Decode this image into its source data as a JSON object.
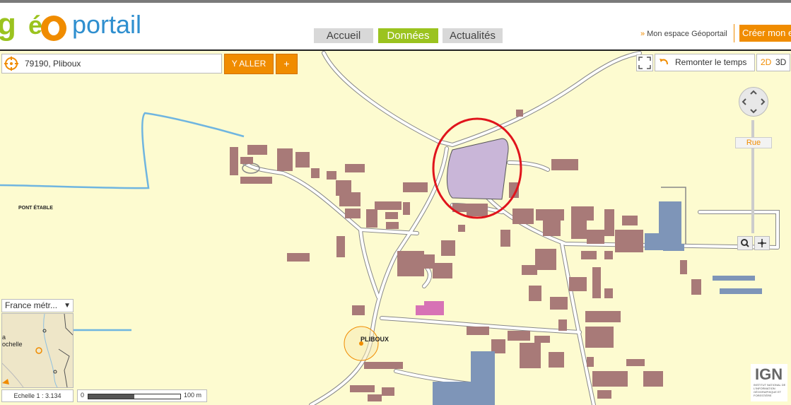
{
  "header": {
    "logo": {
      "g": "g",
      "portail": "portail"
    },
    "nav": [
      {
        "label": "Accueil"
      },
      {
        "label": "Données"
      },
      {
        "label": "Actualités"
      }
    ],
    "espace_label": "Mon espace Géoportail",
    "creer_label": "Créer mon e"
  },
  "map": {
    "search": {
      "value": "79190, Pliboux"
    },
    "aller_label": "Y ALLER",
    "plus_label": "+",
    "remonter_label": "Remonter le temps",
    "mode_2d": "2D",
    "mode_3d": "3D",
    "zoom_level_label": "Rue",
    "labels": {
      "pont_etable": "PONT ÉTABLE",
      "pliboux": "PLIBOUX"
    },
    "minimap": {
      "select_label": "France métr...",
      "city_label": "a\nochelle"
    },
    "echelle_label": "Echelle 1 :  3.134",
    "scale": {
      "min": "0",
      "max": "100 m"
    },
    "ign": {
      "logo": "IGN",
      "text": "INSTITUT NATIONAL DE L'INFORMATION GÉOGRAPHIQUE ET FORESTIÈRE"
    }
  },
  "colors": {
    "accent_orange": "#f08c00",
    "nav_green": "#9bc31f",
    "map_background": "#fdfbd0",
    "building": "#a87a78",
    "highlight_circle": "#e0141c",
    "parcel_fill": "#c9b6d8"
  }
}
